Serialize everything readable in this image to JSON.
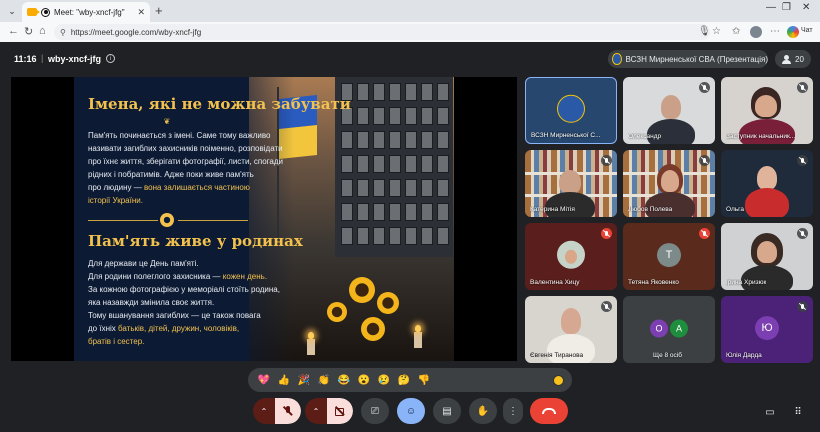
{
  "browser": {
    "tab_title": "Meet: \"wby-xncf-jfg\"",
    "url": "https://meet.google.com/wby-xncf-jfg",
    "chat_label": "Чат"
  },
  "meeting": {
    "time": "11:16",
    "separator": "|",
    "code": "wby-xncf-jfg",
    "presenter": "ВСЗН Мирненської СВА (Презентація)",
    "participants_count": "20"
  },
  "slide": {
    "heading1": "Імена, які не можна забувати",
    "para1": [
      "Пам'ять починається з імені. Саме тому важливо",
      "називати загиблих захисників поіменно, розповідати",
      "про їхнє життя, зберігати фотографії, листи, спогади",
      "рідних і побратимів. Адже поки живе пам'ять"
    ],
    "para1_last_prefix": "про людину — ",
    "para1_last_highlight": "вона залишається частиною",
    "para1_highlight_line2": "історії України.",
    "heading2": "Пам'ять живе у родинах",
    "para2_line1": "Для держави це День пам'яті.",
    "para2_line2_prefix": "Для родини полеглого захисника — ",
    "para2_line2_highlight": "кожен день.",
    "para2_line3": "За кожною фотографією у меморіалі стоїть родина,",
    "para2_line4": "яка назавжди змінила своє життя.",
    "para2_line5": "Тому вшанування загиблих — це також повага",
    "para2_line6_prefix": "до їхніх ",
    "para2_line6_highlight": "батьків, дітей, дружин, чоловіків,",
    "para2_line7_highlight": "братів і сестер."
  },
  "tiles": [
    {
      "name": "ВСЗН Мирненської С...",
      "muted": false
    },
    {
      "name": "Олександр",
      "muted": true
    },
    {
      "name": "Заступник начальник...",
      "muted": true
    },
    {
      "name": "Катерина Мітiя",
      "muted": true
    },
    {
      "name": "Любов Полева",
      "muted": true
    },
    {
      "name": "Ольга",
      "muted": true
    },
    {
      "name": "Валентина Хицу",
      "muted": true
    },
    {
      "name": "Тетяна Яковенко",
      "muted": true,
      "initial": "Т"
    },
    {
      "name": "Ірина Хризюк",
      "muted": true
    },
    {
      "name": "Євгенія Тиранова",
      "muted": true
    },
    {
      "name": "Ще 8 осіб",
      "initials": [
        "О",
        "А"
      ]
    },
    {
      "name": "Юлія Дарда",
      "muted": true,
      "initial": "Ю"
    }
  ],
  "reactions": [
    "💖",
    "👍",
    "🎉",
    "👏",
    "😂",
    "😮",
    "😢",
    "🤔",
    "👎"
  ],
  "colors": {
    "accent_gold": "#f2c14e",
    "leave_red": "#ea4335",
    "active_blue": "#8ab4f8",
    "avatar_teal": "#7c8a8a",
    "avatar_purple": "#7b3fb1"
  },
  "icons": {
    "mic": "mic-off-icon",
    "camera": "camera-off-icon",
    "present": "present-screen-icon",
    "emoji": "emoji-icon",
    "captions": "captions-icon",
    "hand": "raise-hand-icon",
    "more": "more-vert-icon",
    "leave": "call-end-icon",
    "chat": "chat-icon",
    "activities": "apps-grid-icon"
  }
}
